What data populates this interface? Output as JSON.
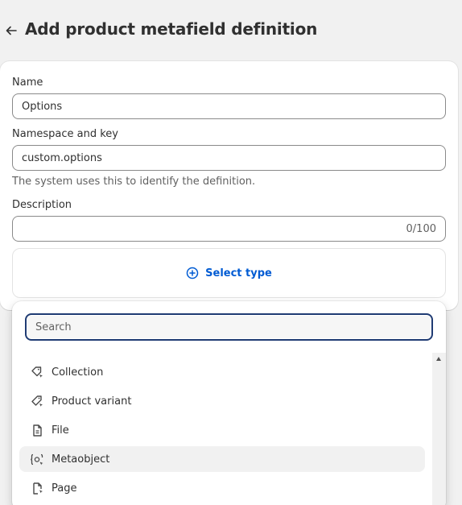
{
  "header": {
    "title": "Add product metafield definition"
  },
  "form": {
    "name_label": "Name",
    "name_value": "Options",
    "namespace_label": "Namespace and key",
    "namespace_value": "custom.options",
    "namespace_help": "The system uses this to identify the definition.",
    "description_label": "Description",
    "description_value": "",
    "description_counter": "0/100",
    "select_type_label": "Select type"
  },
  "popover": {
    "search_placeholder": "Search",
    "items": [
      {
        "label": "Collection",
        "icon": "collection-icon"
      },
      {
        "label": "Product variant",
        "icon": "product-variant-icon"
      },
      {
        "label": "File",
        "icon": "file-icon"
      },
      {
        "label": "Metaobject",
        "icon": "metaobject-icon",
        "active": true
      },
      {
        "label": "Page",
        "icon": "page-icon"
      }
    ]
  },
  "colors": {
    "accent": "#005bd3",
    "focus_ring": "#1f3b73",
    "background": "#f1f1f1"
  }
}
